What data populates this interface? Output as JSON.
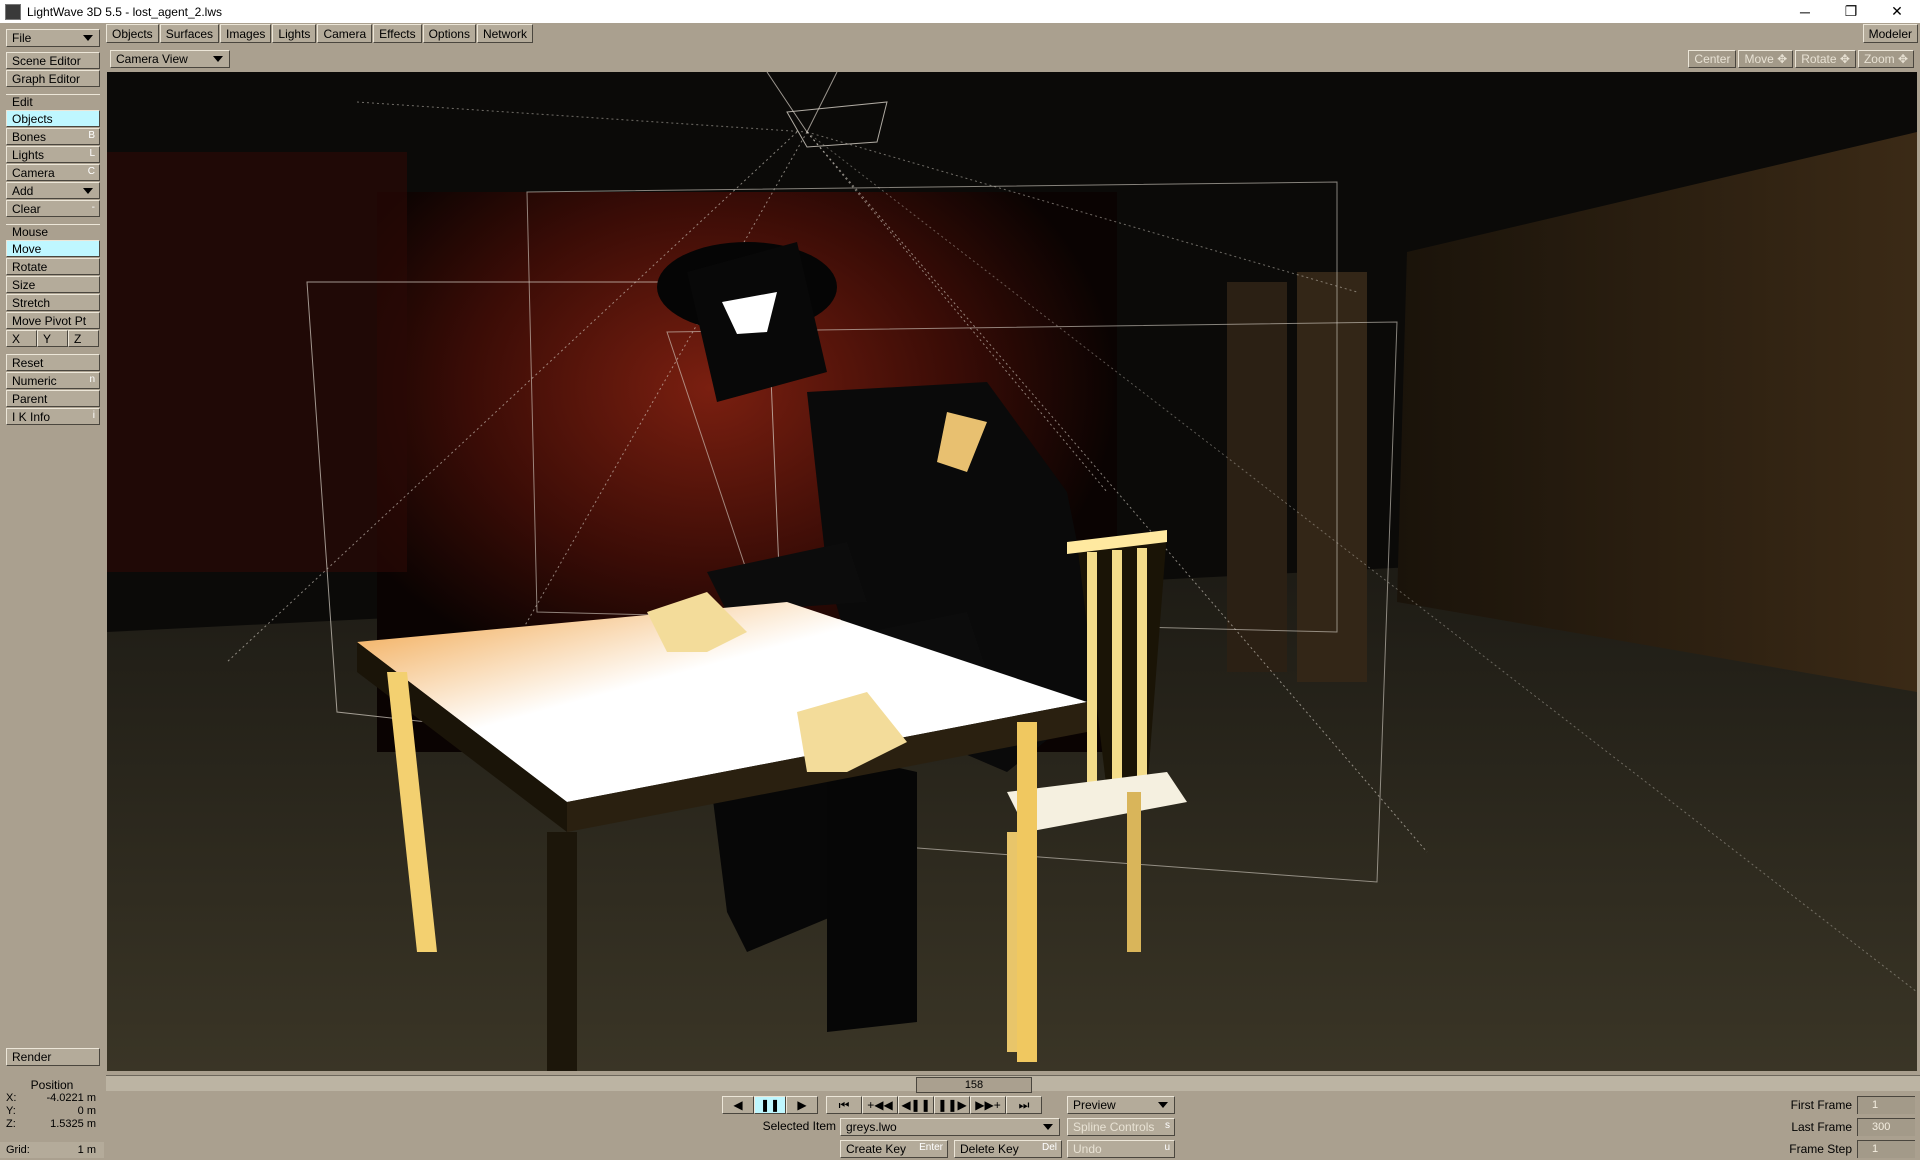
{
  "window": {
    "title": "LightWave 3D 5.5 - lost_agent_2.lws",
    "controls": [
      "─",
      "❐",
      "✕"
    ]
  },
  "menu": {
    "file": "File",
    "tabs": [
      "Objects",
      "Surfaces",
      "Images",
      "Lights",
      "Camera",
      "Effects",
      "Options",
      "Network"
    ],
    "modeler": "Modeler"
  },
  "sidebar": {
    "scene_editor": "Scene Editor",
    "graph_editor": "Graph Editor",
    "edit_label": "Edit",
    "edit_items": [
      {
        "label": "Objects",
        "key": ""
      },
      {
        "label": "Bones",
        "key": "B"
      },
      {
        "label": "Lights",
        "key": "L"
      },
      {
        "label": "Camera",
        "key": "C"
      },
      {
        "label": "Add",
        "key": ""
      },
      {
        "label": "Clear",
        "key": "-"
      }
    ],
    "mouse_label": "Mouse",
    "mouse_items": [
      {
        "label": "Move",
        "key": ""
      },
      {
        "label": "Rotate",
        "key": ""
      },
      {
        "label": "Size",
        "key": ""
      },
      {
        "label": "Stretch",
        "key": ""
      },
      {
        "label": "Move Pivot Pt",
        "key": ""
      }
    ],
    "axes": [
      "X",
      "Y",
      "Z"
    ],
    "other_items": [
      {
        "label": "Reset",
        "key": ""
      },
      {
        "label": "Numeric",
        "key": "n"
      },
      {
        "label": "Parent",
        "key": ""
      },
      {
        "label": "I K Info",
        "key": "i"
      }
    ],
    "render": "Render"
  },
  "viewport": {
    "view_mode": "Camera View",
    "nav": [
      "Center",
      "Move ✥",
      "Rotate ✥",
      "Zoom ✥"
    ]
  },
  "position": {
    "title": "Position",
    "x_label": "X:",
    "x": "-4.0221 m",
    "y_label": "Y:",
    "y": "0 m",
    "z_label": "Z:",
    "z": "1.5325 m",
    "grid_label": "Grid:",
    "grid": "1 m"
  },
  "timeline": {
    "current_frame": "158"
  },
  "transport": {
    "buttons": [
      "◀",
      "❚❚",
      "▶",
      "⏮",
      "+◀◀",
      "◀❚❚",
      "❚❚▶",
      "▶▶+",
      "⏭"
    ]
  },
  "controls": {
    "preview": "Preview",
    "selected_item_label": "Selected Item",
    "selected_item": "greys.lwo",
    "spline_controls": "Spline Controls",
    "spline_key": "s",
    "create_key": "Create Key",
    "create_key_hotkey": "Enter",
    "delete_key": "Delete Key",
    "delete_key_hotkey": "Del",
    "undo": "Undo",
    "undo_key": "u"
  },
  "frames": {
    "first_label": "First Frame",
    "first": "1",
    "last_label": "Last Frame",
    "last": "300",
    "step_label": "Frame Step",
    "step": "1"
  },
  "colors": {
    "active_button": "#bff7ff",
    "panel_bg": "#aaa08f",
    "button_bg": "#b4ab9a"
  }
}
